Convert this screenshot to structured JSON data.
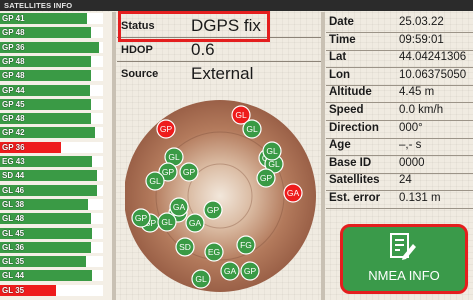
{
  "header": {
    "title": "SATELLITES INFO"
  },
  "satellites": [
    {
      "label": "GP 41",
      "strength": 0.83
    },
    {
      "label": "GP 48",
      "strength": 0.87
    },
    {
      "label": "GP 36",
      "strength": 0.94
    },
    {
      "label": "GP 48",
      "strength": 0.87
    },
    {
      "label": "GP 48",
      "strength": 0.87
    },
    {
      "label": "GP 44",
      "strength": 0.86
    },
    {
      "label": "GP 45",
      "strength": 0.87
    },
    {
      "label": "GP 48",
      "strength": 0.87
    },
    {
      "label": "GP 42",
      "strength": 0.9
    },
    {
      "label": "GP 36",
      "strength": 0.58,
      "weak": true
    },
    {
      "label": "EG 43",
      "strength": 0.88
    },
    {
      "label": "SD 44",
      "strength": 0.92
    },
    {
      "label": "GL 46",
      "strength": 0.92
    },
    {
      "label": "GL 38",
      "strength": 0.84
    },
    {
      "label": "GL 48",
      "strength": 0.87
    },
    {
      "label": "GL 45",
      "strength": 0.88
    },
    {
      "label": "GL 36",
      "strength": 0.87
    },
    {
      "label": "GL 35",
      "strength": 0.82
    },
    {
      "label": "GL 44",
      "strength": 0.88
    },
    {
      "label": "GL 35",
      "strength": 0.53,
      "weak": true
    }
  ],
  "status_panel": {
    "status_label": "Status",
    "status_value": "DGPS fix",
    "hdop_label": "HDOP",
    "hdop_value": "0.6",
    "source_label": "Source",
    "source_value": "External"
  },
  "skyplot": {
    "markers": [
      {
        "label": "GL",
        "type": "ok"
      },
      {
        "label": "GP",
        "type": "weak"
      },
      {
        "label": "GL",
        "type": "weak"
      },
      {
        "label": "GL",
        "type": "ok"
      },
      {
        "label": "GP",
        "type": "ok"
      },
      {
        "label": "GL",
        "type": "ok"
      },
      {
        "label": "GP",
        "type": "ok"
      },
      {
        "label": "GL",
        "type": "ok"
      },
      {
        "label": "GP",
        "type": "ok"
      },
      {
        "label": "GL",
        "type": "ok"
      },
      {
        "label": "GP",
        "type": "ok"
      },
      {
        "label": "GA",
        "type": "weak"
      },
      {
        "label": "GA",
        "type": "ok"
      },
      {
        "label": "GP",
        "type": "ok"
      },
      {
        "label": "GP",
        "type": "ok"
      },
      {
        "label": "GP",
        "type": "ok"
      },
      {
        "label": "GL",
        "type": "ok"
      },
      {
        "label": "GA",
        "type": "ok"
      },
      {
        "label": "SD",
        "type": "ok"
      },
      {
        "label": "EG",
        "type": "ok"
      },
      {
        "label": "FG",
        "type": "ok"
      },
      {
        "label": "GL",
        "type": "ok"
      },
      {
        "label": "GA",
        "type": "ok"
      },
      {
        "label": "GP",
        "type": "ok"
      },
      {
        "label": "GL",
        "type": "ok"
      }
    ]
  },
  "details": [
    {
      "label": "Date",
      "value": "25.03.22"
    },
    {
      "label": "Time",
      "value": "09:59:01"
    },
    {
      "label": "Lat",
      "value": "44.04241306"
    },
    {
      "label": "Lon",
      "value": "10.06375050"
    },
    {
      "label": "Altitude",
      "value": "4.45 m"
    },
    {
      "label": "Speed",
      "value": "0.0 km/h"
    },
    {
      "label": "Direction",
      "value": "000°"
    },
    {
      "label": "Age",
      "value": "–,- s"
    },
    {
      "label": "Base ID",
      "value": "0000"
    },
    {
      "label": "Satellites",
      "value": "24"
    },
    {
      "label": "Est. error",
      "value": "0.131 m"
    }
  ],
  "nmea_button": {
    "label": "NMEA INFO",
    "icon": "document-pencil-icon"
  },
  "colors": {
    "ok": "#3a9a45",
    "weak": "#ee1c1c",
    "highlight": "#e41e1e",
    "button": "#3a9a4a"
  }
}
